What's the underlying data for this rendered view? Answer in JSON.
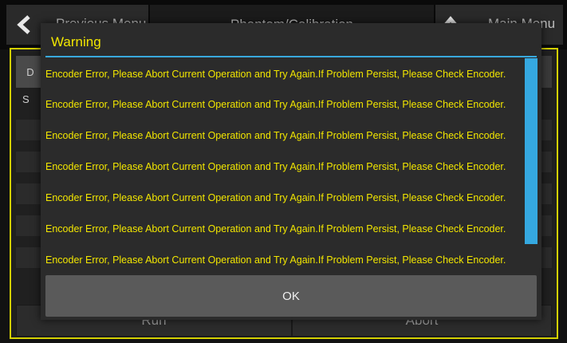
{
  "background": {
    "prev_menu_label": "Previous Menu",
    "screen_title": "Phantom/Calibration",
    "main_menu_label": "Main Menu",
    "tab_label": "D",
    "side_label": "S",
    "run_label": "Run",
    "abort_label": "Abort"
  },
  "dialog": {
    "title": "Warning",
    "messages": [
      "Encoder Error, Please Abort Current Operation and Try Again.If Problem Persist, Please Check Encoder.",
      "Encoder Error, Please Abort Current Operation and Try Again.If Problem Persist, Please Check Encoder.",
      "Encoder Error, Please Abort Current Operation and Try Again.If Problem Persist, Please Check Encoder.",
      "Encoder Error, Please Abort Current Operation and Try Again.If Problem Persist, Please Check Encoder.",
      "Encoder Error, Please Abort Current Operation and Try Again.If Problem Persist, Please Check Encoder.",
      "Encoder Error, Please Abort Current Operation and Try Again.If Problem Persist, Please Check Encoder.",
      "Encoder Error, Please Abort Current Operation and Try Again.If Problem Persist, Please Check Encoder."
    ],
    "ok_label": "OK"
  },
  "colors": {
    "warning_text": "#f2e600",
    "accent_blue": "#39a9dd",
    "frame_yellow": "#d4d000"
  }
}
